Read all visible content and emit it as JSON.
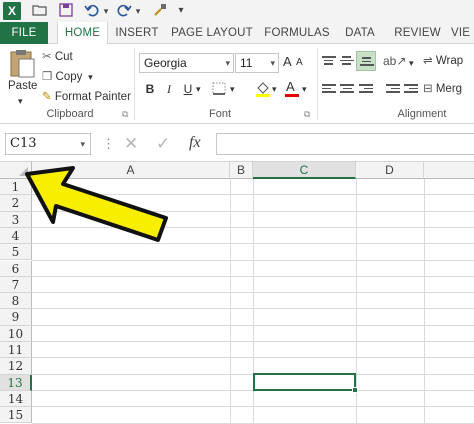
{
  "qat": {
    "app_icon": "X",
    "icons": [
      "excel-logo-icon",
      "open-folder-icon",
      "save-icon",
      "undo-icon",
      "redo-icon",
      "format-painter-icon",
      "customize-chevron-icon"
    ]
  },
  "tabs": [
    {
      "label": "FILE"
    },
    {
      "label": "HOME"
    },
    {
      "label": "INSERT"
    },
    {
      "label": "PAGE LAYOUT"
    },
    {
      "label": "FORMULAS"
    },
    {
      "label": "DATA"
    },
    {
      "label": "REVIEW"
    },
    {
      "label": "VIE"
    }
  ],
  "ribbon": {
    "clipboard": {
      "paste": "Paste",
      "cut": "Cut",
      "copy": "Copy",
      "format_painter": "Format Painter",
      "label": "Clipboard"
    },
    "font": {
      "font_name": "Georgia",
      "font_size": "11",
      "bold": "B",
      "italic": "I",
      "underline": "U",
      "label": "Font",
      "grow": "A",
      "shrink": "A",
      "font_color_letter": "A"
    },
    "alignment": {
      "wrap": "Wrap",
      "merge": "Merg",
      "label": "Alignment"
    }
  },
  "formula_bar": {
    "name_box": "C13",
    "fx": "fx",
    "value": ""
  },
  "grid": {
    "columns": [
      "A",
      "B",
      "C",
      "D"
    ],
    "rows": [
      "1",
      "2",
      "3",
      "4",
      "5",
      "6",
      "7",
      "8",
      "9",
      "10",
      "11",
      "12",
      "13",
      "14",
      "15"
    ],
    "selected_cell": "C13"
  },
  "colors": {
    "accent": "#217346",
    "arrow_fill": "#f7ee00",
    "arrow_stroke": "#111111"
  }
}
